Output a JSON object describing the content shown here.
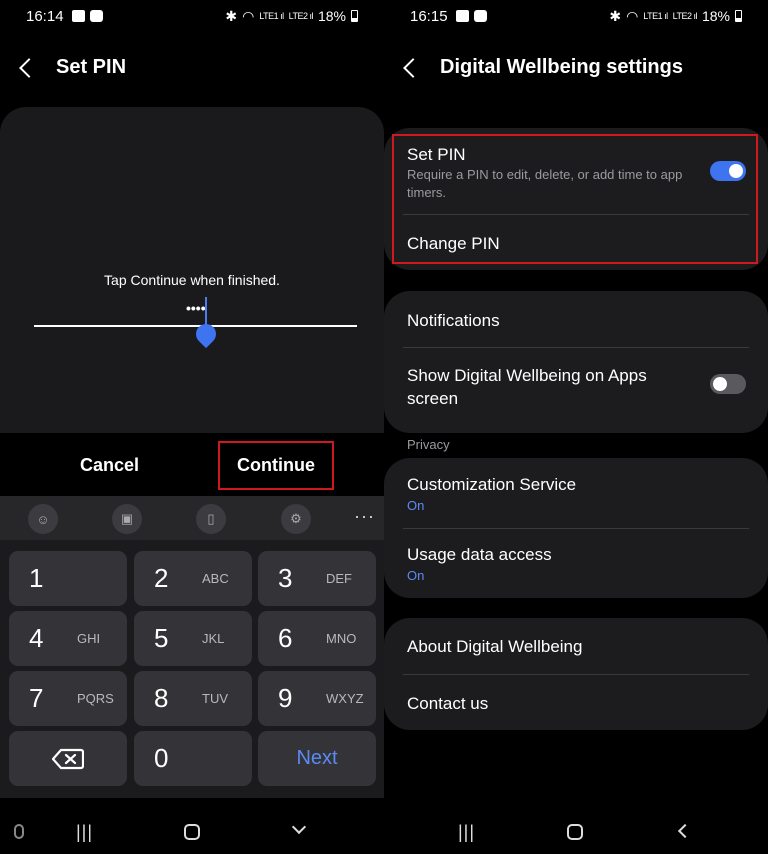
{
  "left": {
    "status": {
      "time": "16:14",
      "battery": "18%"
    },
    "header": {
      "title": "Set PIN"
    },
    "pin": {
      "hint": "Tap Continue when finished.",
      "dots": "••••"
    },
    "actions": {
      "cancel": "Cancel",
      "continue": "Continue"
    },
    "keyboard": {
      "keys": [
        {
          "num": "1",
          "letters": ""
        },
        {
          "num": "2",
          "letters": "ABC"
        },
        {
          "num": "3",
          "letters": "DEF"
        },
        {
          "num": "4",
          "letters": "GHI"
        },
        {
          "num": "5",
          "letters": "JKL"
        },
        {
          "num": "6",
          "letters": "MNO"
        },
        {
          "num": "7",
          "letters": "PQRS"
        },
        {
          "num": "8",
          "letters": "TUV"
        },
        {
          "num": "9",
          "letters": "WXYZ"
        }
      ],
      "zero": "0",
      "next": "Next",
      "more": "···"
    }
  },
  "right": {
    "status": {
      "time": "16:15",
      "battery": "18%"
    },
    "header": {
      "title": "Digital Wellbeing settings"
    },
    "pin_card": {
      "set_pin_title": "Set PIN",
      "set_pin_desc": "Require a PIN to edit, delete, or add time to app timers.",
      "set_pin_enabled": true,
      "change_pin": "Change PIN"
    },
    "general_card": {
      "notifications": "Notifications",
      "show_on_apps": "Show Digital Wellbeing on Apps screen",
      "show_on_apps_enabled": false
    },
    "privacy": {
      "label": "Privacy",
      "customization": "Customization Service",
      "customization_status": "On",
      "usage_access": "Usage data access",
      "usage_status": "On"
    },
    "about_card": {
      "about": "About Digital Wellbeing",
      "contact": "Contact us"
    }
  },
  "colors": {
    "accent": "#3e74f0",
    "highlight": "#d0191e",
    "card": "#1c1c1f"
  }
}
